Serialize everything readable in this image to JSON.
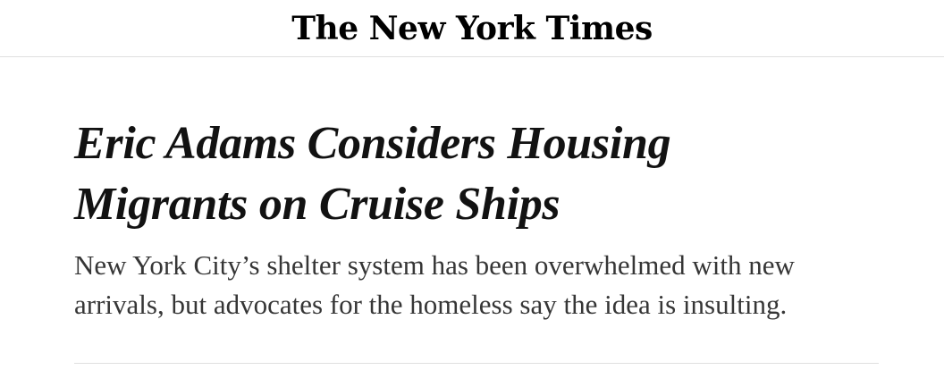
{
  "masthead": {
    "title": "The New York Times"
  },
  "article": {
    "headline_line1": "Eric Adams Considers Housing",
    "headline_line2": "Migrants on Cruise Ships",
    "summary_line1": "New York City’s shelter system has been overwhelmed with new",
    "summary_line2": "arrivals, but advocates for the homeless say the idea is insulting."
  },
  "colors": {
    "background": "#ffffff",
    "headline": "#121212",
    "summary": "#363636",
    "rule": "#dfdfdf"
  }
}
